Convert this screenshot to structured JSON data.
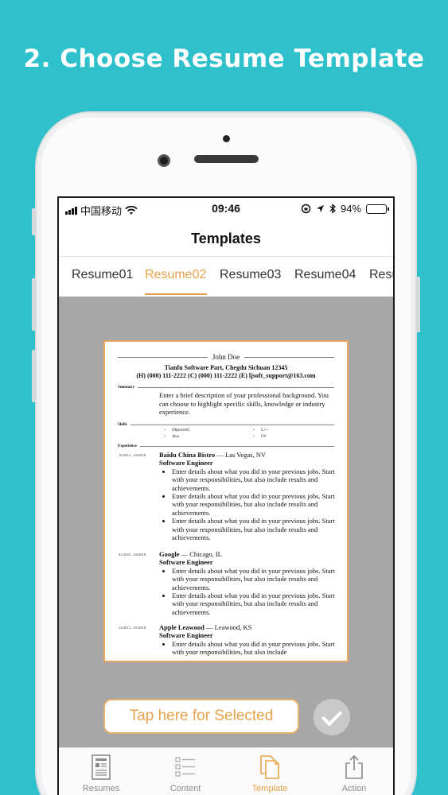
{
  "headline": "2. Choose Resume Template",
  "status": {
    "carrier": "中国移动",
    "time": "09:46",
    "battery": "94%",
    "battery_level": 0.94
  },
  "nav": {
    "title": "Templates"
  },
  "tabs": [
    {
      "label": "Resume01",
      "active": false
    },
    {
      "label": "Resume02",
      "active": true
    },
    {
      "label": "Resume03",
      "active": false
    },
    {
      "label": "Resume04",
      "active": false
    },
    {
      "label": "Resu",
      "active": false
    }
  ],
  "resume": {
    "name": "John Doe",
    "address": "Tianfu Software Part, Chegdu Sichuan 12345",
    "contact": "(H) (000) 111-2222 (C) (000) 111-2222 (E) ljsoft_support@163.com",
    "summary_heading": "Summary",
    "summary_text": "Enter a brief description of your professional background. You can choose to highlight specific skills, knowledge or industry experience.",
    "skills_heading": "Skills",
    "skills_col1": [
      "ObjectiveC",
      "Java"
    ],
    "skills_col2": [
      "C++",
      "C#"
    ],
    "experience_heading": "Experience",
    "jobs": [
      {
        "dates": "10/2014 – 03/2018",
        "company": "Baidu China Bistro",
        "location": "Las Vegas, NV",
        "title": "Software Engineer",
        "bullets": [
          "Enter details about what you did in your previous jobs. Start with your responsibilities, but also include results and achievements.",
          "Enter details about what you did in your previous jobs. Start with your responsibilities, but also include results and achievements.",
          "Enter details about what you did in your previous jobs. Start with your responsibilities, but also include results and achievements."
        ]
      },
      {
        "dates": "01/2018 – 04/2018",
        "company": "Google",
        "location": "Chicago, IL",
        "title": "Software Engineer",
        "bullets": [
          "Enter details about what you did in your previous jobs. Start with your responsibilities, but also include results and achievements.",
          "Enter details about what you did in your previous jobs. Start with your responsibilities, but also include results and achievements."
        ]
      },
      {
        "dates": "12/2013 – 05/2018",
        "company": "Apple Leawood",
        "location": "Leawood, KS",
        "title": "Software Engineer",
        "bullets": [
          "Enter details about what you did in your previous jobs. Start with your responsibilities, but also include"
        ]
      }
    ]
  },
  "select_button": "Tap here for Selected",
  "tabbar": [
    {
      "label": "Resumes",
      "icon": "resume-document-icon",
      "active": false
    },
    {
      "label": "Content",
      "icon": "list-icon",
      "active": false
    },
    {
      "label": "Template",
      "icon": "template-copy-icon",
      "active": true
    },
    {
      "label": "Action",
      "icon": "share-icon",
      "active": false
    }
  ],
  "colors": {
    "background": "#2ec0cb",
    "accent": "#e6a24a",
    "preview_bg": "#a7a7a7"
  }
}
